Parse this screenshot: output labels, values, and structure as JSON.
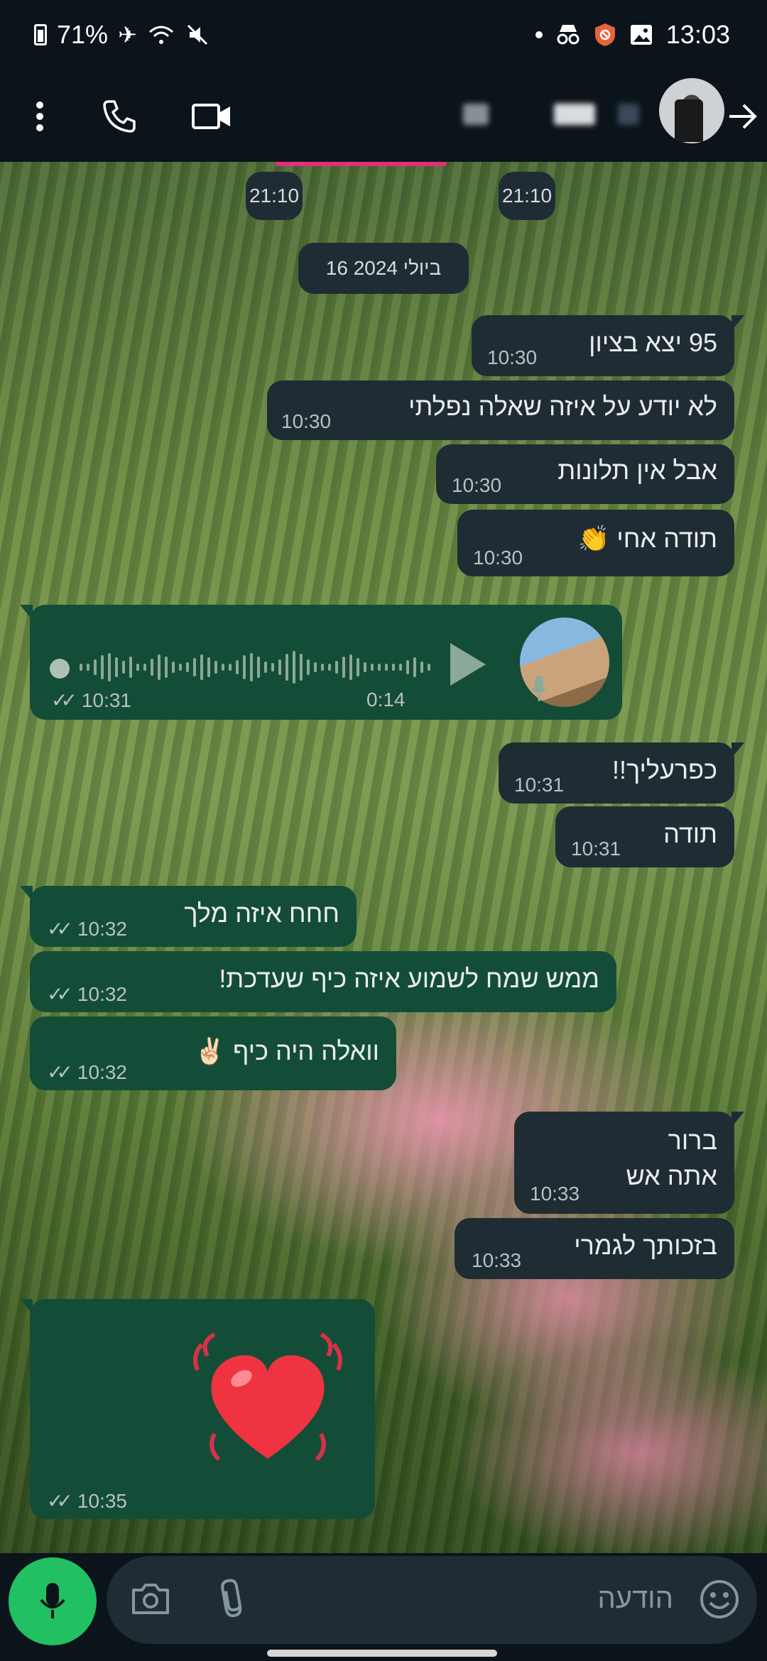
{
  "status_bar": {
    "battery": "71%",
    "time": "13:03"
  },
  "chat": {
    "earlier_times": [
      "21:10",
      "21:10"
    ],
    "date_chip": "16 ביולי 2024",
    "messages": [
      {
        "dir": "in",
        "text": "95 יצא בציון",
        "time": "10:30"
      },
      {
        "dir": "in",
        "text": "לא יודע על איזה שאלה נפלתי",
        "time": "10:30"
      },
      {
        "dir": "in",
        "text": "אבל אין תלונות",
        "time": "10:30"
      },
      {
        "dir": "in",
        "text": "תודה אחי 👏",
        "time": "10:30"
      },
      {
        "dir": "out",
        "type": "voice",
        "duration": "0:14",
        "time": "10:31"
      },
      {
        "dir": "in",
        "text": "כפרעליך!!",
        "time": "10:31"
      },
      {
        "dir": "in",
        "text": "תודה",
        "time": "10:31"
      },
      {
        "dir": "out",
        "text": "חחח איזה מלך",
        "time": "10:32"
      },
      {
        "dir": "out",
        "text": "ממש שמח לשמוע איזה כיף שעדכת!",
        "time": "10:32"
      },
      {
        "dir": "out",
        "text": "וואלה היה כיף ✌🏻",
        "time": "10:32"
      },
      {
        "dir": "in",
        "text_line1": "ברור",
        "text_line2": "אתה אש",
        "time": "10:33"
      },
      {
        "dir": "in",
        "text": "בזכותך לגמרי",
        "time": "10:33"
      },
      {
        "dir": "out",
        "type": "sticker",
        "emoji": "❤️",
        "time": "10:35"
      }
    ]
  },
  "input": {
    "placeholder": "הודעה"
  },
  "colors": {
    "incoming_bubble": "#1f2c34",
    "outgoing_bubble": "#144d37",
    "accent": "#21c063"
  }
}
